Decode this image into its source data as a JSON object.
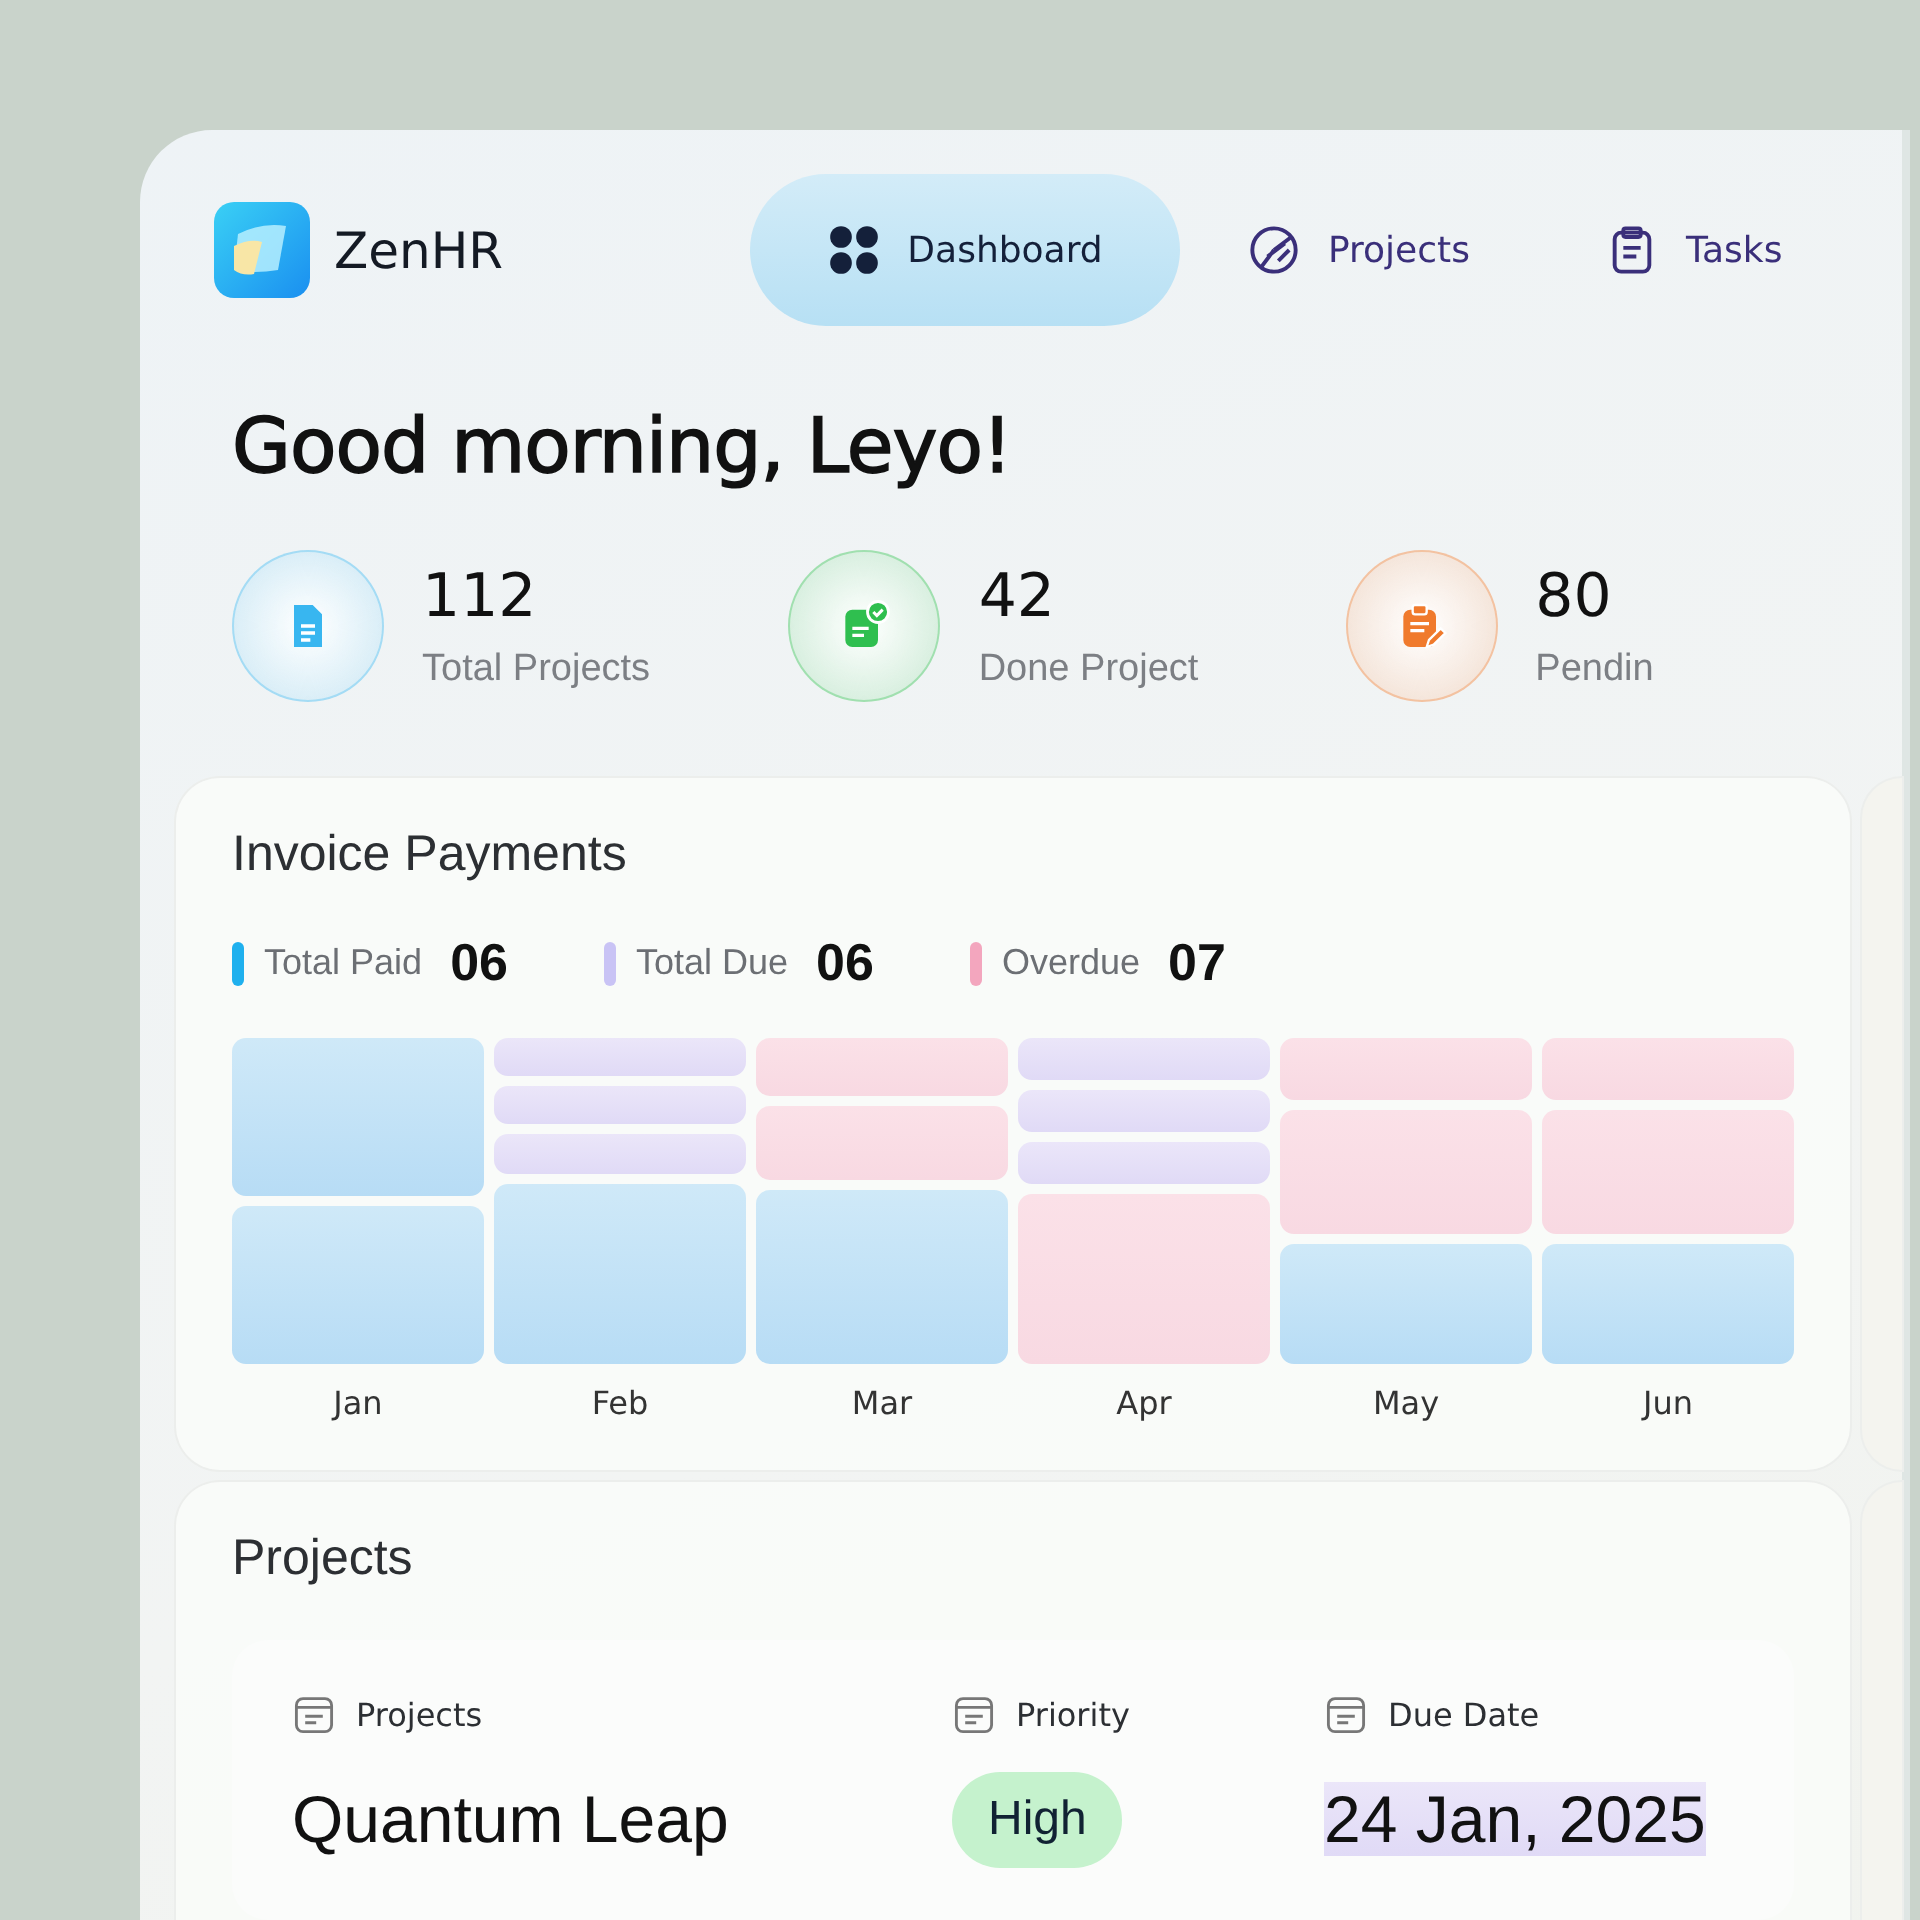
{
  "brand": {
    "name": "ZenHR"
  },
  "tabs": [
    {
      "label": "Dashboard",
      "selected": true
    },
    {
      "label": "Projects",
      "selected": false
    },
    {
      "label": "Tasks",
      "selected": false
    }
  ],
  "greeting": "Good morning, Leyo!",
  "stats": [
    {
      "value": "112",
      "label": "Total Projects",
      "color": "#38b6f0"
    },
    {
      "value": "42",
      "label": "Done Project",
      "color": "#2fbf4f"
    },
    {
      "value": "80",
      "label": "Pendin",
      "color": "#f07a2c"
    }
  ],
  "invoice": {
    "title": "Invoice Payments",
    "legend": [
      {
        "label": "Total Paid",
        "value": "06",
        "color": "#1fb0ee"
      },
      {
        "label": "Total Due",
        "value": "06",
        "color": "#c9c3f5"
      },
      {
        "label": "Overdue",
        "value": "07",
        "color": "#f3a6be"
      }
    ],
    "months": [
      {
        "label": "Jan",
        "blocks": [
          {
            "kind": "paid"
          },
          {
            "kind": "paid"
          }
        ]
      },
      {
        "label": "Feb",
        "blocks": [
          {
            "kind": "due"
          },
          {
            "kind": "due"
          },
          {
            "kind": "due"
          },
          {
            "kind": "paid"
          }
        ]
      },
      {
        "label": "Mar",
        "blocks": [
          {
            "kind": "overdue"
          },
          {
            "kind": "overdue"
          },
          {
            "kind": "paid"
          }
        ]
      },
      {
        "label": "Apr",
        "blocks": [
          {
            "kind": "due"
          },
          {
            "kind": "due"
          },
          {
            "kind": "due"
          },
          {
            "kind": "overdue"
          }
        ]
      },
      {
        "label": "May",
        "blocks": [
          {
            "kind": "overdue"
          },
          {
            "kind": "overdue"
          },
          {
            "kind": "paid"
          }
        ]
      },
      {
        "label": "Jun",
        "blocks": [
          {
            "kind": "overdue"
          },
          {
            "kind": "overdue"
          },
          {
            "kind": "paid"
          }
        ]
      }
    ]
  },
  "projects": {
    "title": "Projects",
    "columns": [
      "Projects",
      "Priority",
      "Due Date"
    ],
    "rows": [
      {
        "name": "Quantum Leap",
        "priority": "High",
        "due": "24 Jan, 2025"
      }
    ]
  }
}
